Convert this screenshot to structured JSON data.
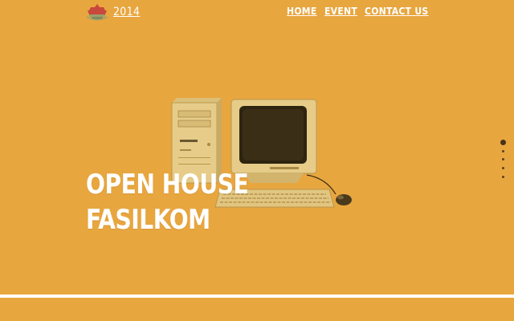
{
  "header": {
    "year": "2014",
    "nav": [
      {
        "label": "HOME"
      },
      {
        "label": "EVENT"
      },
      {
        "label": "CONTACT US"
      }
    ]
  },
  "hero": {
    "title_line1": "OPEN HOUSE",
    "title_line2": "FASILKOM"
  },
  "pager": {
    "count": 5,
    "active": 1
  },
  "colors": {
    "background": "#E8A63F",
    "text": "#FFFFFF",
    "logo_red": "#C8483C"
  },
  "icons": [
    "logo-icon",
    "computer-illustration"
  ]
}
